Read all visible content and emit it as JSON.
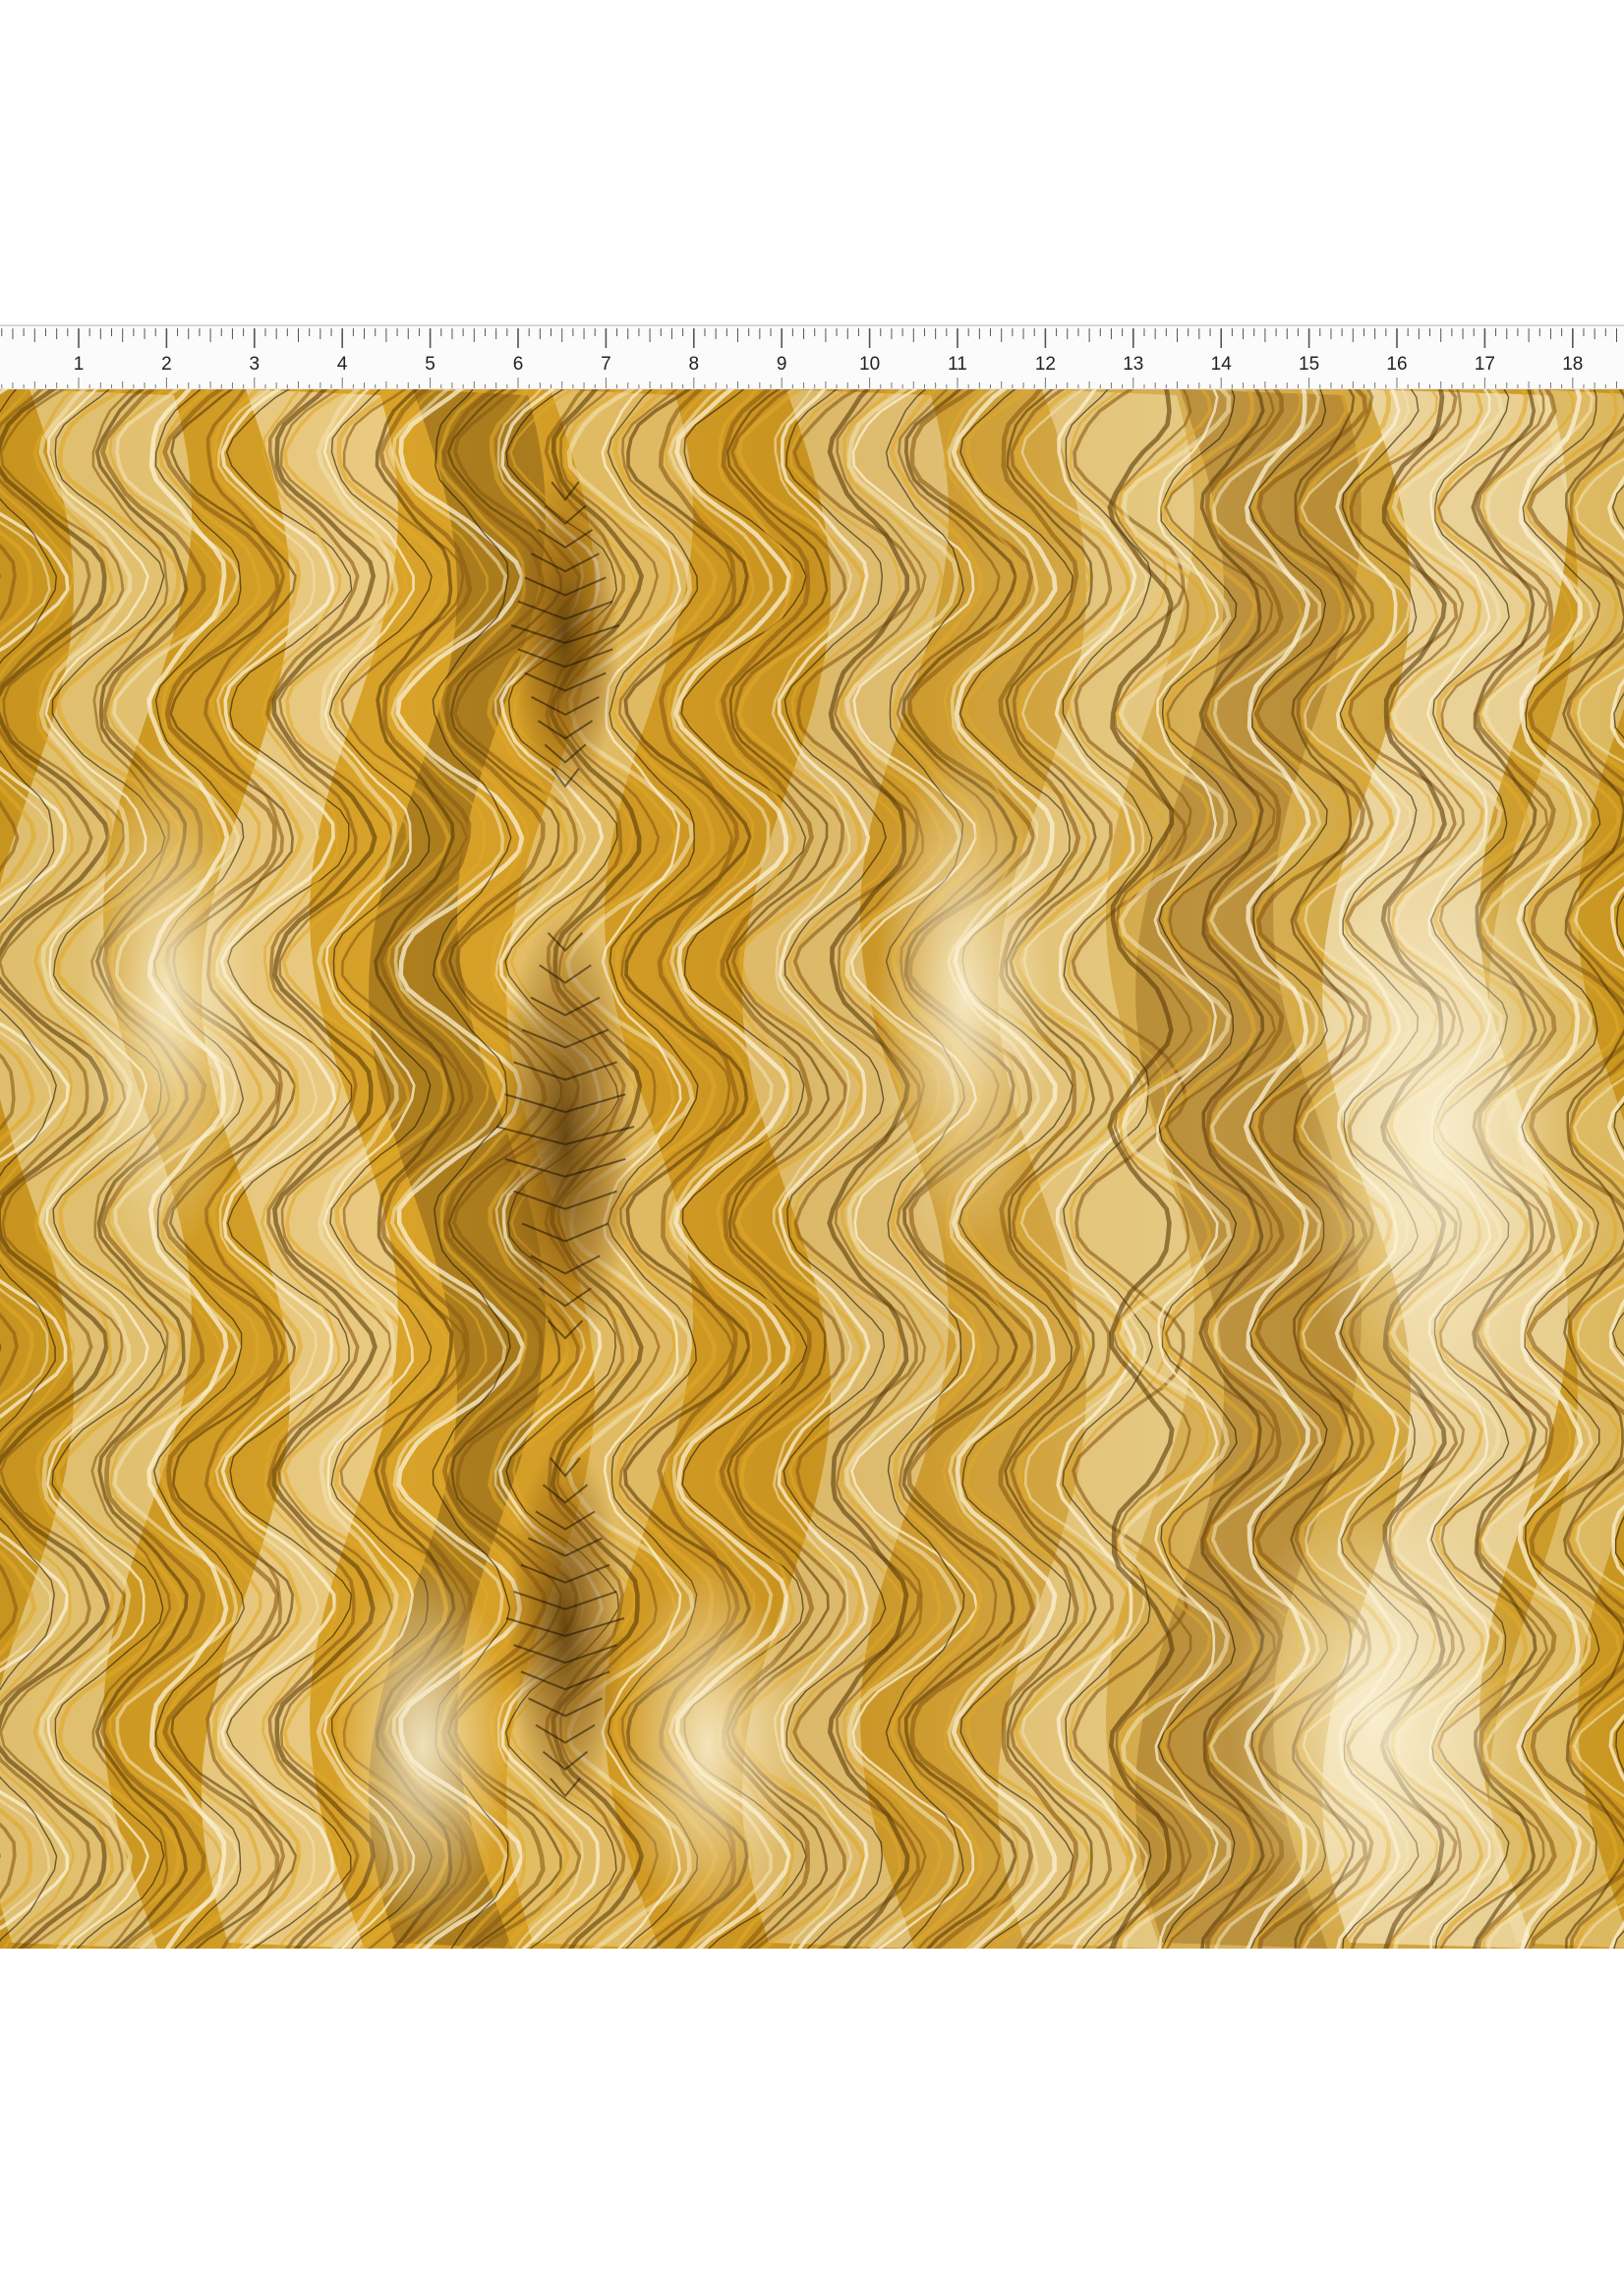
{
  "ruler": {
    "labels": [
      "1",
      "2",
      "3",
      "4",
      "5",
      "6",
      "7",
      "8",
      "9",
      "10",
      "11",
      "12",
      "13",
      "14",
      "15",
      "16",
      "17",
      "18"
    ]
  },
  "fabric": {
    "pattern": "marbled-feather",
    "colors": {
      "base": "#c9961f",
      "gold": "#e0a82a",
      "light": "#f3e2b0",
      "cream": "#fbf2d6",
      "dark": "#5a3a08",
      "brown": "#8a5a12",
      "ink": "#1e1204"
    }
  }
}
